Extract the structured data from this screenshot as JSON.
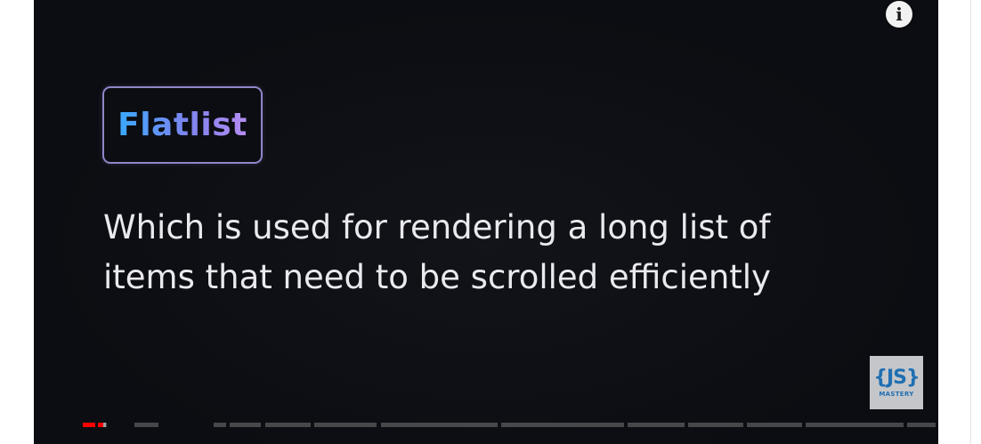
{
  "video": {
    "topic_label": "Flatlist",
    "caption_lines": [
      "Which is used for rendering a long list of",
      "items that need to be scrolled efficiently"
    ],
    "info_icon": "info-icon",
    "info_glyph": "i",
    "watermark": {
      "icon": "js-mastery-logo-icon",
      "mark": "{JS}",
      "sub": "MASTERY"
    },
    "colors": {
      "background": "#0b0d12",
      "caption_text": "#e9e9ee",
      "badge_border": "#8f86c9",
      "label_gradient_start": "#3aa8ff",
      "label_gradient_end": "#b48cf2",
      "progress_played": "#ff0000",
      "progress_unplayed": "#787878"
    },
    "progress": {
      "chapters_played": 1,
      "current_chapter_fill": 0.55,
      "current_chapter_buffered": 0.9,
      "chapter_count": 16
    }
  }
}
